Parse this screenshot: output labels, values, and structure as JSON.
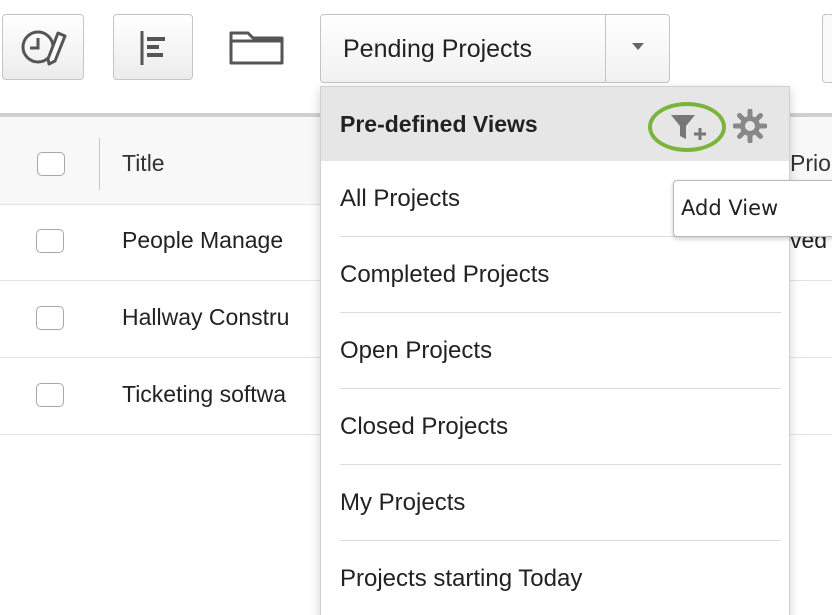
{
  "toolbar": {
    "timesheet_icon": "clock-pencil-icon",
    "gantt_icon": "gantt-chart-icon",
    "folder_icon": "folder-icon",
    "view_select": {
      "value": "Pending Projects",
      "caret_icon": "caret-down-icon"
    }
  },
  "grid": {
    "columns": [
      "Title",
      "Prio"
    ],
    "rows": [
      {
        "title": "People Manage",
        "priority": "ved"
      },
      {
        "title": "Hallway Constru",
        "priority": ""
      },
      {
        "title": "Ticketing softwa",
        "priority": ""
      }
    ]
  },
  "views_menu": {
    "header": "Pre-defined Views",
    "add_view_icon": "filter-plus-icon",
    "settings_icon": "gear-icon",
    "accent_color": "#7ab43c",
    "items": [
      "All Projects",
      "Completed Projects",
      "Open Projects",
      "Closed Projects",
      "My Projects",
      "Projects starting Today"
    ]
  },
  "tooltip": {
    "text": "Add View"
  }
}
